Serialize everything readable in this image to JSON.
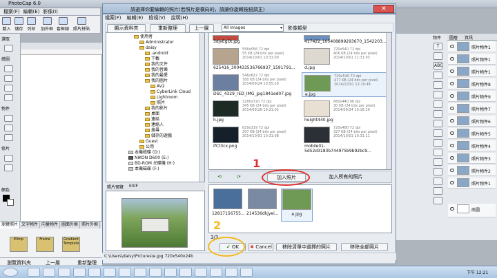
{
  "app": {
    "title": "PhotoCap 6.0",
    "menu": [
      "檔案(F)",
      "編輯(E)",
      "影像(I)"
    ],
    "toolbar": [
      "載入",
      "儲存",
      "列印",
      "加外框",
      "套框線",
      "照片拼貼"
    ]
  },
  "left_panel": {
    "labels": [
      "選取",
      "繪圖",
      "物件",
      "修片",
      "顏色"
    ]
  },
  "dialog": {
    "title": "請選擇你要編輯的照片(若照片是橫向的，請讓你旋轉按鈕調正)",
    "menu": [
      "檔案(F)",
      "編輯(E)",
      "檢視(V)",
      "說明(H)"
    ],
    "show_tree_label": "顯示資料夾",
    "refresh_label": "重新整理",
    "up_label": "上一層",
    "filter": "All Images",
    "type_label": "影像類型",
    "tree": [
      "使用者",
      "Administrator",
      "daisy",
      ".android",
      "下載",
      "我的文件",
      "我的音樂",
      "我的最愛",
      "我的圖片",
      "AV2",
      "CyberLink Cloud",
      "Lightroom",
      "照片",
      "我的影片",
      "桌面",
      "連結",
      "連絡人",
      "搜尋",
      "儲存的遊戲",
      "Guest",
      "公用",
      "本機磁碟 (D:)",
      "NIKON D600 (E:)",
      "BD-ROM 光碟機 (H:)",
      "本機磁碟 (F:)"
    ],
    "files": [
      {
        "name": "3djvEgDt.jpg",
        "info": ""
      },
      {
        "name": "417422_105408899293670_1542203...",
        "info": ""
      },
      {
        "name": "625416_300433536766937_1591791...",
        "info": "556x556 72 dpi\n55 KB (24 bits per pixel)\n2014/10/01 10:31:00"
      },
      {
        "name": "d.jpg",
        "info": "720x540 72 dpi\n406 KB (24 bits per pixel)\n2014/10/01 11:31:03"
      },
      {
        "name": "DSC_4329_rED_IMG_jpg1841ed07.jpg",
        "info": "546x822 72 dpi\n180 KB (24 bits per pixel)\n2014/09/24 10:55:28"
      },
      {
        "name": "e.jpg",
        "info": "720x540 72 dpi\n477 KB (24 bits per pixel)\n2014/10/01 12:10:48"
      },
      {
        "name": "h.jpg",
        "info": "1280x720 72 dpi\n345 KB (24 bits per pixel)\n2014/09/28 19:21:02"
      },
      {
        "name": "height440.jpg",
        "info": "660x440 96 dpi\n30 KB (24 bits per pixel)\n2014/09/24 10:16:29"
      },
      {
        "name": "IfCt3cx.png",
        "info": "629x319 72 dpi\n297 KB (24 bits per pixel)\n2014/10/01 10:31:08"
      },
      {
        "name": "mobile01-5d52d3183b744975b9b92bc9...",
        "info": "720x480 72 dpi\n327 KB (24 bits per pixel)\n2014/10/01 10:31:11"
      }
    ],
    "add_photo": "加入照片",
    "add_all": "加入所有的照片",
    "selected": [
      {
        "name": "12817156755..."
      },
      {
        "name": "214536dkjyei..."
      },
      {
        "name": "e.jpg"
      }
    ],
    "count": "3/3",
    "ok": "OK",
    "cancel": "Cancel",
    "remove_selected": "移除清單中選擇的照片",
    "remove_all": "移除全部照片",
    "preview_tabs": [
      "照片預覽",
      "EXIF"
    ],
    "status": "C:\\Users\\daisy\\Pictures\\e.jpg   720x540x24b"
  },
  "right_panel": {
    "tabs": [
      "圖層",
      "資訊"
    ],
    "header": "物件",
    "layers": [
      "照片物件1",
      "照片物件1",
      "照片物件1",
      "照片物件8",
      "照片物件9",
      "照片物件7",
      "照片物件6",
      "照片物件5",
      "照片物件4",
      "照片物件3",
      "照片物件2",
      "照片物件1",
      "底圖"
    ]
  },
  "bottom": {
    "tabs": [
      "瀏覽照片",
      "文字物件",
      "向量物件",
      "圖面外框",
      "照片外框"
    ],
    "frames": [
      "Ellmp",
      "Frame",
      "Gradient Template"
    ],
    "browse": "瀏覽資料夾",
    "up": "上一層",
    "refresh": "重新整理"
  },
  "annotations": {
    "one": "1",
    "two": "2"
  },
  "clock": "下午 12:21"
}
